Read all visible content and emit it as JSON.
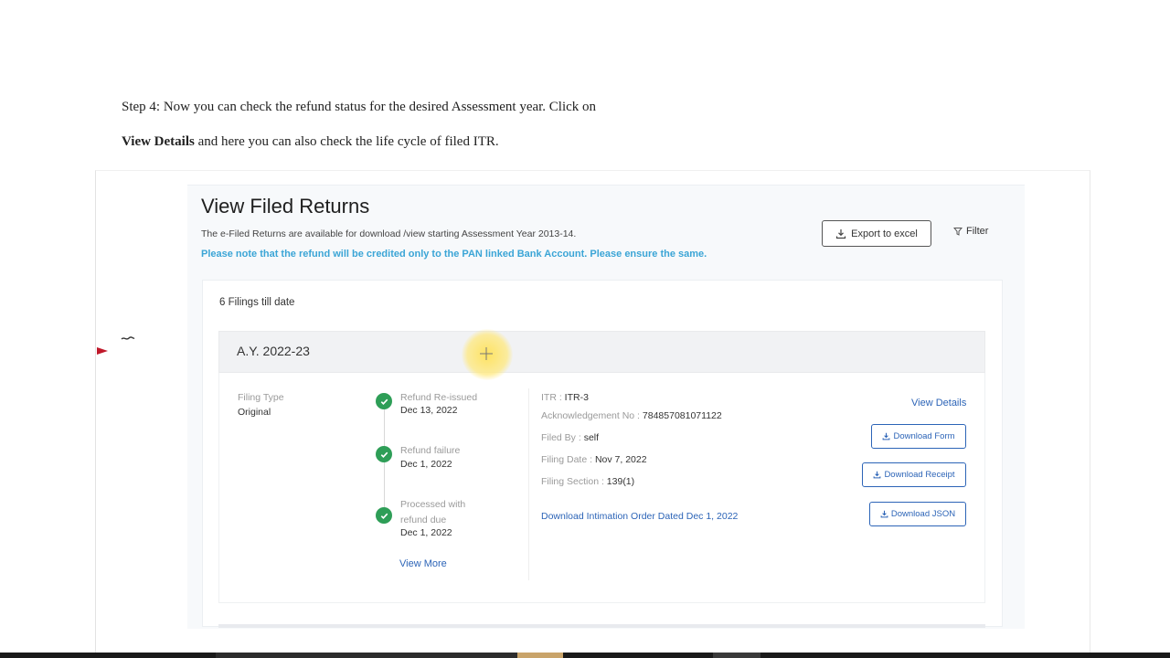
{
  "instructions": {
    "line1": "Step 4: Now you can check the refund status for the desired Assessment year. Click on",
    "line2_bold": "View Details",
    "line2_rest": " and here you can also check the life cycle of filed ITR."
  },
  "screen": {
    "title": "View Filed Returns",
    "subtitle": "The e-Filed Returns are available for download /view starting Assessment Year 2013-14.",
    "note": "Please note that the refund will be credited only to the PAN linked Bank Account. Please ensure the same.",
    "export_label": "Export to excel",
    "filter_label": "Filter",
    "filings_count": "6 Filings till date",
    "filing": {
      "ay": "A.Y. 2022-23",
      "filing_type_label": "Filing Type",
      "filing_type_value": "Original",
      "timeline": [
        {
          "status": "Refund Re-issued",
          "date": "Dec 13, 2022"
        },
        {
          "status": "Refund failure",
          "date": "Dec 1, 2022"
        },
        {
          "status": "Processed with refund due",
          "date": "Dec 1, 2022"
        }
      ],
      "view_more": "View More",
      "itr_label": "ITR :",
      "itr_value": "ITR-3",
      "ack_label": "Acknowledgement No :",
      "ack_value": "784857081071122",
      "filed_by_label": "Filed By :",
      "filed_by_value": "self",
      "filing_date_label": "Filing Date :",
      "filing_date_value": "Nov 7, 2022",
      "filing_section_label": "Filing Section :",
      "filing_section_value": "139(1)",
      "intimation_link": "Download Intimation Order Dated Dec 1, 2022",
      "view_details": "View Details",
      "download_form": "Download Form",
      "download_receipt": "Download Receipt",
      "download_json": "Download JSON"
    }
  },
  "colors": {
    "link_blue": "#2c64b7",
    "note_blue": "#3ba5d6",
    "success_green": "#2e9e57",
    "cursor_highlight": "#ffe25a"
  },
  "icons": [
    "download-icon",
    "filter-icon",
    "check-circle-icon",
    "cursor-crosshair-icon",
    "red-arrow-icon"
  ]
}
